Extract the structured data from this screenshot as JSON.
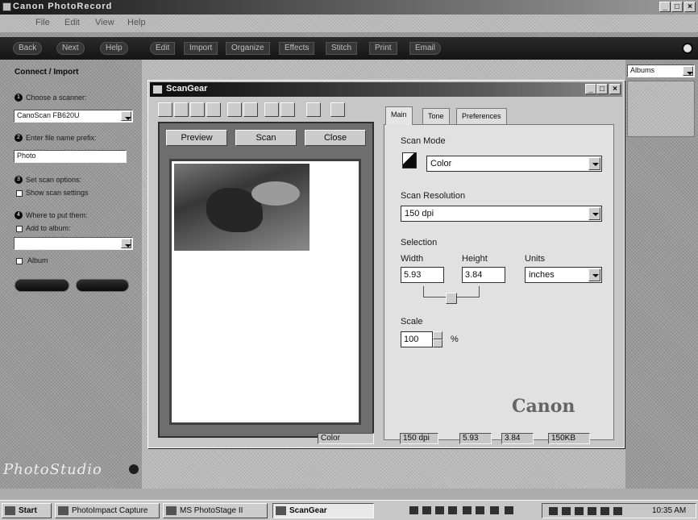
{
  "app": {
    "title": "Canon PhotoRecord",
    "menu": [
      "File",
      "Edit",
      "View",
      "Help"
    ],
    "title_buttons": [
      "_",
      "□",
      "×"
    ]
  },
  "nav": {
    "left_buttons": [
      "Back",
      "Next",
      "Help"
    ],
    "tabs": [
      "Edit",
      "Import",
      "Organize",
      "Effects",
      "Stitch",
      "Print",
      "Email"
    ]
  },
  "left_panel": {
    "heading": "Connect / Import",
    "steps": [
      {
        "number": "1",
        "label": "Choose a scanner:"
      },
      {
        "number": "2",
        "label": "Enter file name prefix:"
      },
      {
        "number": "3",
        "label": "Set scan options:"
      },
      {
        "number": "4",
        "label": "Where to put them:"
      }
    ],
    "scanner_value": "CanoScan FB620U",
    "prefix_value": "Photo",
    "scan_option_label": "Show scan settings",
    "add_album_label": "Add to album:",
    "album_value": "",
    "album_checkbox_label": "Album",
    "logo_text": "PhotoStudio",
    "colors": {
      "panel": "#9a9a9a"
    }
  },
  "right_panel": {
    "dropdown_value": "Albums"
  },
  "scangear": {
    "title": "ScanGear",
    "title_buttons": [
      "_",
      "□",
      "×"
    ],
    "toolbar_icons": [
      "select-icon",
      "zoom-in-icon",
      "zoom-out-icon",
      "fit-icon",
      "color-icon",
      "crop-icon",
      "mirror-icon",
      "rotate-icon",
      "help-icon"
    ],
    "preview_buttons": {
      "preview": "Preview",
      "scan": "Scan",
      "close": "Close"
    },
    "tabs": [
      "Main",
      "Tone",
      "Preferences"
    ],
    "scan_mode": {
      "label": "Scan Mode",
      "value": "Color"
    },
    "resolution": {
      "label": "Scan Resolution",
      "value": "150 dpi"
    },
    "selection": {
      "label": "Selection",
      "width_label": "Width",
      "height_label": "Height",
      "units_label": "Units",
      "width_value": "5.93",
      "height_value": "3.84",
      "units_value": "inches"
    },
    "scale": {
      "label": "Scale",
      "value": "100",
      "unit": "%"
    },
    "brand": "Canon",
    "status": {
      "mode": "Color",
      "dpi": "150 dpi",
      "width": "5.93",
      "height": "3.84",
      "size": "150KB"
    }
  },
  "taskbar": {
    "start_label": "Start",
    "tasks": [
      "PhotoImpact Capture",
      "MS PhotoStage II",
      "ScanGear"
    ],
    "clock": "10:35 AM"
  }
}
